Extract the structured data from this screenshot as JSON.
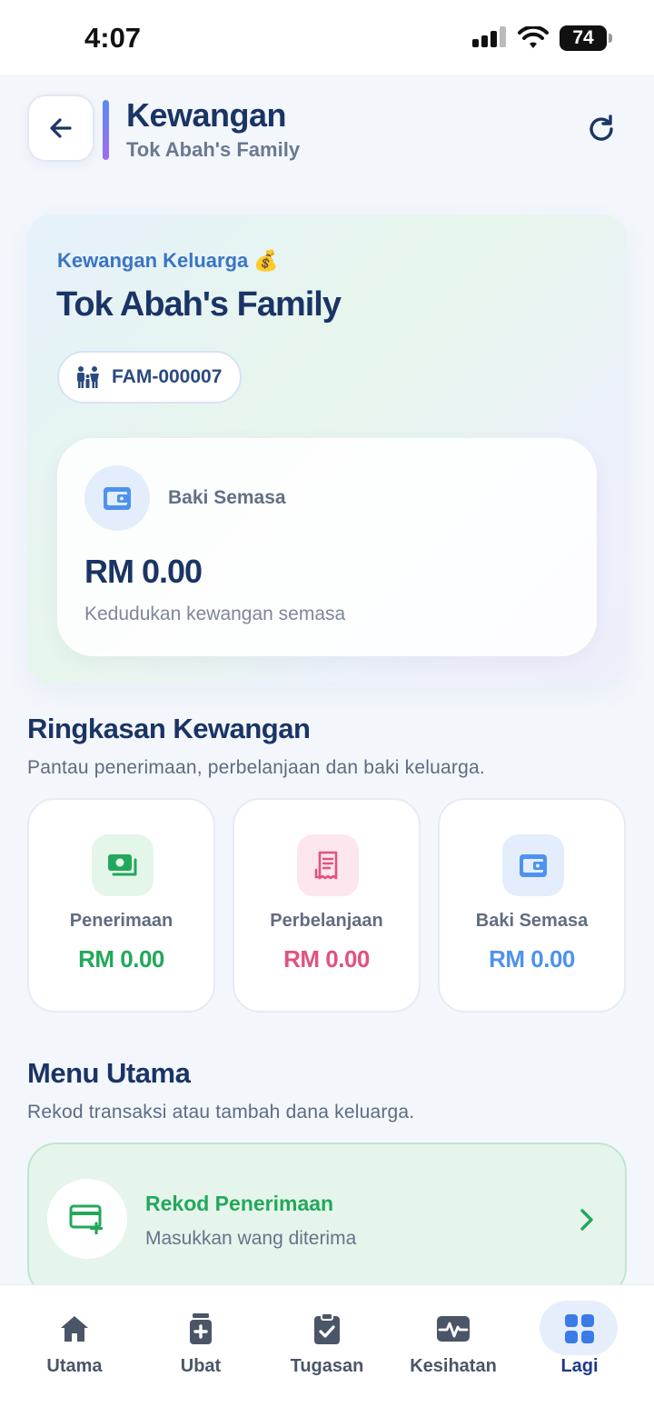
{
  "status": {
    "time": "4:07",
    "battery": "74"
  },
  "header": {
    "title": "Kewangan",
    "subtitle": "Tok Abah's Family"
  },
  "family_card": {
    "kicker": "Kewangan Keluarga 💰",
    "title": "Tok Abah's Family",
    "family_id": "FAM-000007",
    "balance": {
      "label": "Baki Semasa",
      "amount": "RM 0.00",
      "description": "Kedudukan kewangan semasa"
    }
  },
  "summary": {
    "title": "Ringkasan Kewangan",
    "description": "Pantau penerimaan, perbelanjaan dan baki keluarga.",
    "cards": [
      {
        "label": "Penerimaan",
        "value": "RM 0.00",
        "icon": "cash-icon",
        "color": "#22a85a",
        "bg": "#e4f6ea"
      },
      {
        "label": "Perbelanjaan",
        "value": "RM 0.00",
        "icon": "receipt-icon",
        "color": "#e2527f",
        "bg": "#fde6ee"
      },
      {
        "label": "Baki Semasa",
        "value": "RM 0.00",
        "icon": "wallet-icon",
        "color": "#4e92ee",
        "bg": "#e3edfb"
      }
    ]
  },
  "menu": {
    "title": "Menu Utama",
    "description": "Rekod transaksi atau tambah dana keluarga.",
    "items": [
      {
        "title": "Rekod Penerimaan",
        "subtitle": "Masukkan wang diterima"
      }
    ]
  },
  "nav": {
    "items": [
      {
        "label": "Utama",
        "icon": "home-icon"
      },
      {
        "label": "Ubat",
        "icon": "medicine-icon"
      },
      {
        "label": "Tugasan",
        "icon": "clipboard-check-icon"
      },
      {
        "label": "Kesihatan",
        "icon": "pulse-icon"
      },
      {
        "label": "Lagi",
        "icon": "grid-icon",
        "active": true
      }
    ]
  },
  "colors": {
    "primary": "#1b3466",
    "accent": "#3a74c4",
    "green": "#22a85a",
    "pink": "#e2527f",
    "blue": "#4e92ee"
  }
}
